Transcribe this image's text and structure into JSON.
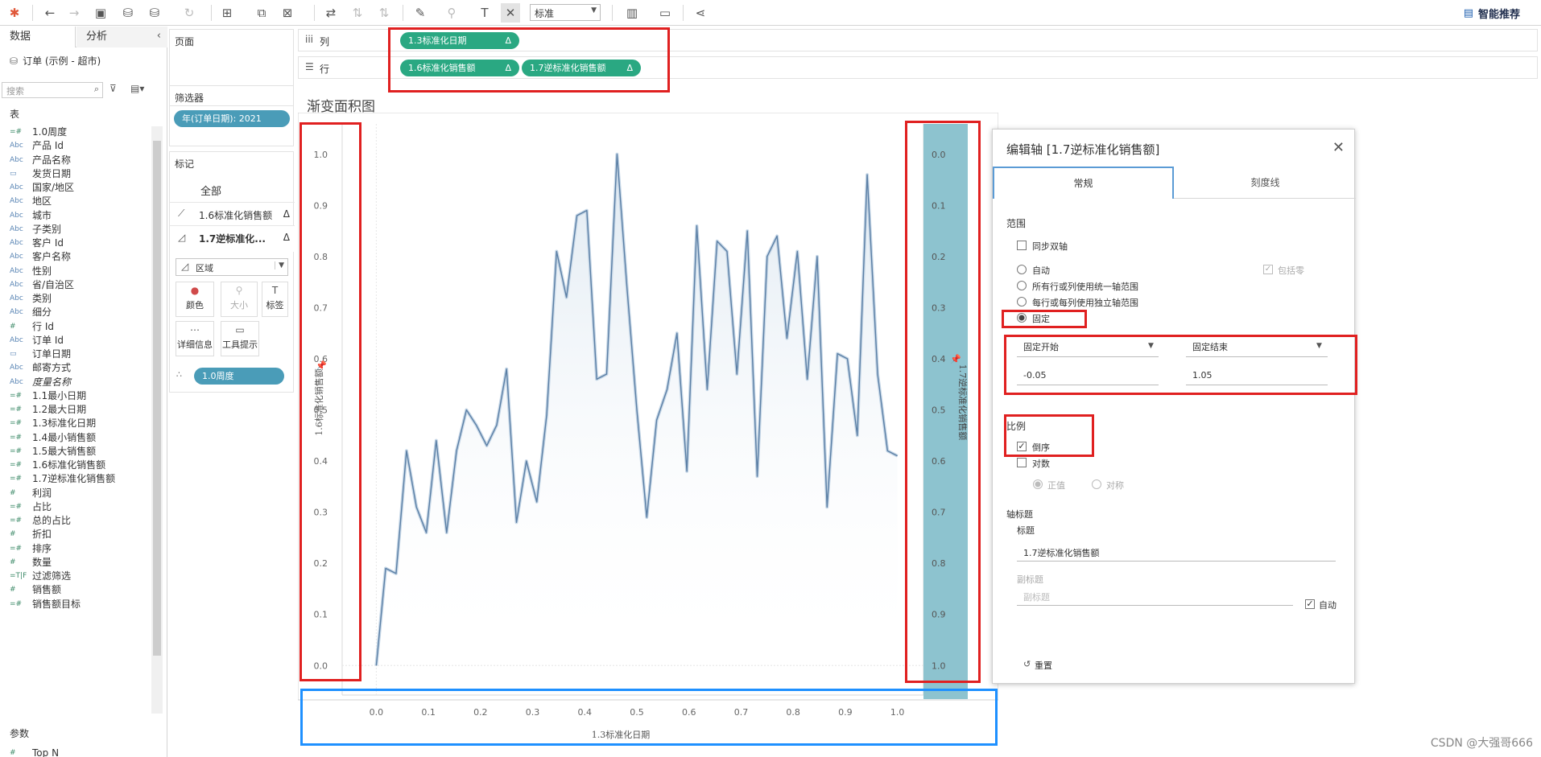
{
  "toolbar": {
    "fit_value": "标准",
    "smart_recommend": "智能推荐"
  },
  "data_pane": {
    "tabs": [
      "数据",
      "分析"
    ],
    "source": "订单 (示例 - 超市)",
    "search_placeholder": "搜索",
    "tables_header": "表",
    "fields": [
      {
        "icon": "=#",
        "name": "1.0周度"
      },
      {
        "icon": "Abc",
        "name": "产品 Id"
      },
      {
        "icon": "Abc",
        "name": "产品名称"
      },
      {
        "icon": "cal",
        "name": "发货日期"
      },
      {
        "icon": "Abc",
        "name": "国家/地区"
      },
      {
        "icon": "Abc",
        "name": "地区"
      },
      {
        "icon": "Abc",
        "name": "城市"
      },
      {
        "icon": "Abc",
        "name": "子类别"
      },
      {
        "icon": "Abc",
        "name": "客户 Id"
      },
      {
        "icon": "Abc",
        "name": "客户名称"
      },
      {
        "icon": "Abc",
        "name": "性别"
      },
      {
        "icon": "Abc",
        "name": "省/自治区"
      },
      {
        "icon": "Abc",
        "name": "类别"
      },
      {
        "icon": "Abc",
        "name": "细分"
      },
      {
        "icon": "#",
        "name": "行 Id"
      },
      {
        "icon": "Abc",
        "name": "订单 Id"
      },
      {
        "icon": "cal",
        "name": "订单日期"
      },
      {
        "icon": "Abc",
        "name": "邮寄方式"
      },
      {
        "icon": "Abc",
        "name": "度量名称"
      },
      {
        "icon": "=#",
        "name": "1.1最小日期"
      },
      {
        "icon": "=#",
        "name": "1.2最大日期"
      },
      {
        "icon": "=#",
        "name": "1.3标准化日期"
      },
      {
        "icon": "=#",
        "name": "1.4最小销售额"
      },
      {
        "icon": "=#",
        "name": "1.5最大销售额"
      },
      {
        "icon": "=#",
        "name": "1.6标准化销售额"
      },
      {
        "icon": "=#",
        "name": "1.7逆标准化销售额"
      },
      {
        "icon": "#",
        "name": "利润"
      },
      {
        "icon": "=#",
        "name": "占比"
      },
      {
        "icon": "=#",
        "name": "总的占比"
      },
      {
        "icon": "#",
        "name": "折扣"
      },
      {
        "icon": "=#",
        "name": "排序"
      },
      {
        "icon": "#",
        "name": "数量"
      },
      {
        "icon": "=T|F",
        "name": "过滤筛选"
      },
      {
        "icon": "#",
        "name": "销售额"
      },
      {
        "icon": "=#",
        "name": "销售额目标"
      }
    ],
    "params_header": "参数",
    "params": [
      {
        "icon": "#",
        "name": "Top N"
      }
    ]
  },
  "pages": {
    "title": "页面"
  },
  "filters": {
    "title": "筛选器",
    "pill": "年(订单日期): 2021"
  },
  "marks": {
    "title": "标记",
    "all": "全部",
    "card1": "1.6标准化销售额",
    "card2": "1.7逆标准化...",
    "mark_type": "区域",
    "buttons": [
      "颜色",
      "大小",
      "标签",
      "详细信息",
      "工具提示"
    ],
    "detail_pill": "1.0周度",
    "delta": "Δ"
  },
  "shelves": {
    "columns_label": "列",
    "rows_label": "行",
    "columns_pills": [
      "1.3标准化日期"
    ],
    "rows_pills": [
      "1.6标准化销售额",
      "1.7逆标准化销售额"
    ],
    "delta": "Δ"
  },
  "sheet": {
    "title": "渐变面积图"
  },
  "chart_data": {
    "type": "area",
    "xlabel": "1.3标准化日期",
    "ylabel_left": "1.6标准化销售额",
    "ylabel_right": "1.7逆标准化销售额",
    "x_ticks": [
      "0.0",
      "0.1",
      "0.2",
      "0.3",
      "0.4",
      "0.5",
      "0.6",
      "0.7",
      "0.8",
      "0.9",
      "1.0"
    ],
    "y_left_ticks": [
      "1.0",
      "0.9",
      "0.8",
      "0.7",
      "0.6",
      "0.5",
      "0.4",
      "0.3",
      "0.2",
      "0.1",
      "0.0"
    ],
    "y_right_ticks": [
      "0.0",
      "0.1",
      "0.2",
      "0.3",
      "0.4",
      "0.5",
      "0.6",
      "0.7",
      "0.8",
      "0.9",
      "1.0"
    ],
    "xlim": [
      -0.05,
      1.05
    ],
    "ylim": [
      -0.02,
      1.05
    ],
    "series": [
      {
        "x": [
          0.0,
          0.018,
          0.038,
          0.058,
          0.077,
          0.096,
          0.115,
          0.135,
          0.154,
          0.173,
          0.192,
          0.212,
          0.231,
          0.25,
          0.269,
          0.288,
          0.308,
          0.327,
          0.346,
          0.365,
          0.385,
          0.404,
          0.423,
          0.442,
          0.462,
          0.481,
          0.5,
          0.519,
          0.538,
          0.558,
          0.577,
          0.596,
          0.615,
          0.635,
          0.654,
          0.673,
          0.692,
          0.712,
          0.731,
          0.75,
          0.769,
          0.788,
          0.808,
          0.827,
          0.846,
          0.865,
          0.885,
          0.904,
          0.923,
          0.942,
          0.962,
          0.981,
          1.0
        ],
        "y": [
          0.0,
          0.19,
          0.18,
          0.42,
          0.31,
          0.26,
          0.44,
          0.26,
          0.42,
          0.5,
          0.47,
          0.43,
          0.47,
          0.58,
          0.28,
          0.4,
          0.32,
          0.49,
          0.81,
          0.72,
          0.88,
          0.89,
          0.56,
          0.57,
          1.0,
          0.74,
          0.5,
          0.29,
          0.48,
          0.54,
          0.65,
          0.38,
          0.86,
          0.54,
          0.83,
          0.81,
          0.57,
          0.85,
          0.37,
          0.8,
          0.84,
          0.64,
          0.81,
          0.56,
          0.8,
          0.31,
          0.61,
          0.6,
          0.45,
          0.96,
          0.57,
          0.42,
          0.41
        ]
      }
    ]
  },
  "dialog": {
    "title": "编辑轴 [1.7逆标准化销售额]",
    "tabs": [
      "常规",
      "刻度线"
    ],
    "range_header": "范围",
    "sync_dual": "同步双轴",
    "radio_auto": "自动",
    "include_zero": "包括零",
    "radio_uniform": "所有行或列使用统一轴范围",
    "radio_independent": "每行或每列使用独立轴范围",
    "radio_fixed": "固定",
    "fixed_start_label": "固定开始",
    "fixed_end_label": "固定结束",
    "fixed_start_value": "-0.05",
    "fixed_end_value": "1.05",
    "scale_header": "比例",
    "reversed": "倒序",
    "log": "对数",
    "positive": "正值",
    "symmetric": "对称",
    "axis_title_header": "轴标题",
    "title_label": "标题",
    "title_value": "1.7逆标准化销售额",
    "subtitle_label": "副标题",
    "subtitle_placeholder": "副标题",
    "auto_label": "自动",
    "reset": "重置"
  },
  "watermark": "CSDN @大强哥666"
}
